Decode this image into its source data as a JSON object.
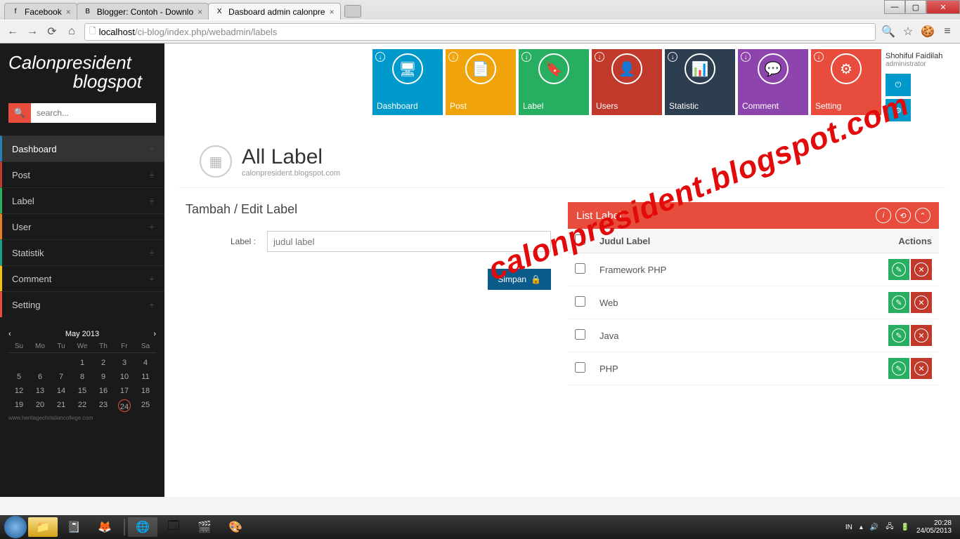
{
  "browser": {
    "tabs": [
      {
        "title": "Facebook",
        "favicon": "f"
      },
      {
        "title": "Blogger: Contoh - Downlo",
        "favicon": "B"
      },
      {
        "title": "Dasboard admin calonpre",
        "favicon": "X"
      }
    ],
    "url_host": "localhost",
    "url_path": "/ci-blog/index.php/webadmin/labels"
  },
  "brand": {
    "line1": "Calonpresident",
    "line2": "blogspot"
  },
  "search_placeholder": "search...",
  "sidebar_items": [
    {
      "label": "Dashboard",
      "cls": "c-blue active"
    },
    {
      "label": "Post",
      "cls": "c-magenta"
    },
    {
      "label": "Label",
      "cls": "c-green"
    },
    {
      "label": "User",
      "cls": "c-orange"
    },
    {
      "label": "Statistik",
      "cls": "c-cyan"
    },
    {
      "label": "Comment",
      "cls": "c-yellow"
    },
    {
      "label": "Setting",
      "cls": "c-red"
    }
  ],
  "calendar": {
    "title": "May 2013",
    "dows": [
      "Su",
      "Mo",
      "Tu",
      "We",
      "Th",
      "Fr",
      "Sa"
    ],
    "weeks": [
      [
        "",
        "",
        "",
        "1",
        "2",
        "3",
        "4"
      ],
      [
        "5",
        "6",
        "7",
        "8",
        "9",
        "10",
        "11"
      ],
      [
        "12",
        "13",
        "14",
        "15",
        "16",
        "17",
        "18"
      ],
      [
        "19",
        "20",
        "21",
        "22",
        "23",
        "24",
        "25"
      ]
    ],
    "today": "24",
    "attrib": "www.heritagechristiancollege.com"
  },
  "tiles": [
    {
      "label": "Dashboard",
      "color": "t-blue",
      "icon": "🖥"
    },
    {
      "label": "Post",
      "color": "t-yellow",
      "icon": "📄"
    },
    {
      "label": "Label",
      "color": "t-green",
      "icon": "🔖"
    },
    {
      "label": "Users",
      "color": "t-red",
      "icon": "👤"
    },
    {
      "label": "Statistic",
      "color": "t-navy",
      "icon": "📊"
    },
    {
      "label": "Comment",
      "color": "t-purple",
      "icon": "💬"
    },
    {
      "label": "Setting",
      "color": "t-orange",
      "icon": "⚙"
    }
  ],
  "user": {
    "name": "Shohiful Faidilah",
    "role": "administrator"
  },
  "page": {
    "title": "All Label",
    "sub": "calonpresident.blogspot.com"
  },
  "form": {
    "heading": "Tambah / Edit Label",
    "label_field": "Label :",
    "placeholder": "judul label",
    "save": "Simpan"
  },
  "list": {
    "heading": "List Label",
    "col_label": "Judul Label",
    "col_actions": "Actions",
    "rows": [
      "Framework PHP",
      "Web",
      "Java",
      "PHP"
    ]
  },
  "watermark": "calonpresident.blogspot.com",
  "taskbar": {
    "lang": "IN",
    "time": "20:28",
    "date": "24/05/2013"
  }
}
